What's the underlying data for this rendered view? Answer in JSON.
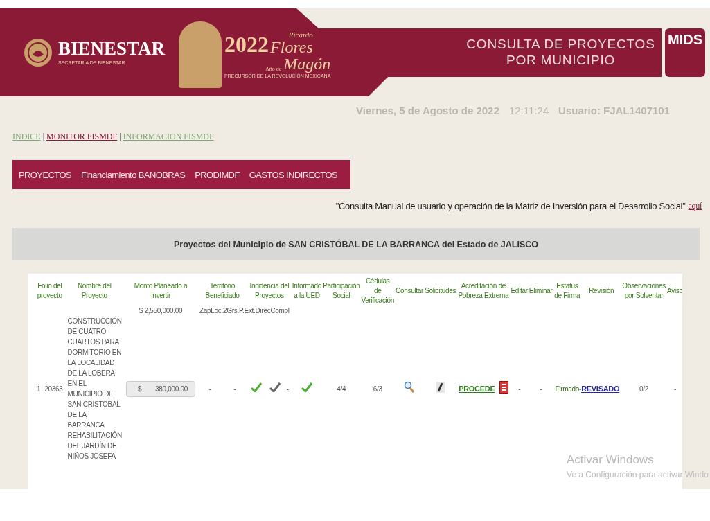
{
  "header": {
    "logo": {
      "title": "BIENESTAR",
      "subtitle": "SECRETARÍA DE BIENESTAR"
    },
    "banner": {
      "year": "2022",
      "first_name": "Ricardo",
      "surname": "Flores",
      "prefix": "Año de",
      "second_surname": "Magón",
      "tagline": "PRECURSOR DE LA REVOLUCIÓN MEXICANA"
    },
    "title_lines": [
      "CONSULTA DE PROYECTOS",
      "POR MUNICIPIO"
    ],
    "badge": "MIDS"
  },
  "session": {
    "date": "Viernes, 5 de Agosto de 2022",
    "time": "12:11:24",
    "user": "Usuario: FJAL1407101"
  },
  "links": [
    {
      "label": "INDICE",
      "active": false
    },
    {
      "label": "MONITOR FISMDF",
      "active": true
    },
    {
      "label": "INFORMACION FISMDF",
      "active": false
    }
  ],
  "link_separators": [
    "|",
    "|"
  ],
  "menu": [
    "PROYECTOS",
    "Financiamiento BANOBRAS",
    "PRODIMDF",
    "GASTOS INDIRECTOS"
  ],
  "manual_note": {
    "text": "\"Consulta Manual de usuario y operación de la Matriz de Inversión para el Desarrollo Social\"",
    "link": "aquí"
  },
  "table": {
    "caption": "Proyectos del Municipio de SAN CRISTÓBAL DE LA BARRANCA del Estado de JALISCO",
    "columns": [
      "Folio del proyecto",
      "Nombre del Proyecto",
      "Monto Planeado a Invertir",
      "Territorio Beneficiado",
      "Incidencia del Proyectos",
      "Informado a la UED",
      "Participación Social",
      "Cédulas de Verificación",
      "Consultar",
      "Solicitudes",
      "Acreditación de Pobreza Extrema",
      "Editar",
      "Eliminar",
      "Estatus de Firma",
      "Revisión",
      "Observaciones por Solventar",
      "Aviso"
    ],
    "totals": {
      "amount": "$ 2,550,000.00",
      "codes": "ZapLoc.2Grs.P.Ext.DirecCompl"
    },
    "rows": [
      {
        "cells": [
          [
            {
              "kind": "text",
              "text": "1"
            },
            {
              "kind": "text",
              "text": "20363"
            }
          ],
          [
            {
              "kind": "name",
              "text": "CONSTRUCCIÓN DE CUATRO CUARTOS PARA DORMITORIO EN LA LOCALIDAD DE LA LOBERA EN EL MUNICIPIO DE SAN CRISTOBAL DE LA BARRANCA REHABILITACIÓN DEL JARDÍN DE NIÑOS JOSEFA"
            }
          ],
          [
            {
              "kind": "amount",
              "currency": "$",
              "value": "380,000.00"
            }
          ],
          [
            {
              "kind": "text",
              "text": "-"
            },
            {
              "kind": "text",
              "text": "-"
            }
          ],
          [
            {
              "kind": "check",
              "color": "#4caf32"
            },
            {
              "kind": "check",
              "color": "#666666"
            },
            {
              "kind": "text",
              "text": "-"
            }
          ],
          [
            {
              "kind": "check",
              "color": "#4caf32"
            }
          ],
          [
            {
              "kind": "text",
              "text": "4/4"
            }
          ],
          [
            {
              "kind": "text",
              "text": "6/3"
            }
          ],
          [
            {
              "kind": "magnifier"
            }
          ],
          [
            {
              "kind": "pencil"
            }
          ],
          [
            {
              "kind": "link",
              "text": "PROCEDE",
              "color": "#2e7d1e"
            },
            {
              "kind": "pdf"
            }
          ],
          [
            {
              "kind": "text",
              "text": "-"
            }
          ],
          [
            {
              "kind": "text",
              "text": "-"
            }
          ],
          [
            {
              "kind": "status",
              "text": "Firmado-"
            }
          ],
          [
            {
              "kind": "link",
              "text": "REVISADO",
              "color": "#2a2aa0"
            }
          ],
          [
            {
              "kind": "text",
              "text": "0/2"
            }
          ],
          [
            {
              "kind": "text",
              "text": "-"
            }
          ]
        ]
      }
    ]
  },
  "os_overlay": {
    "title": "Activar Windows",
    "subtitle": "Ve a Configuración para activar Windo"
  }
}
